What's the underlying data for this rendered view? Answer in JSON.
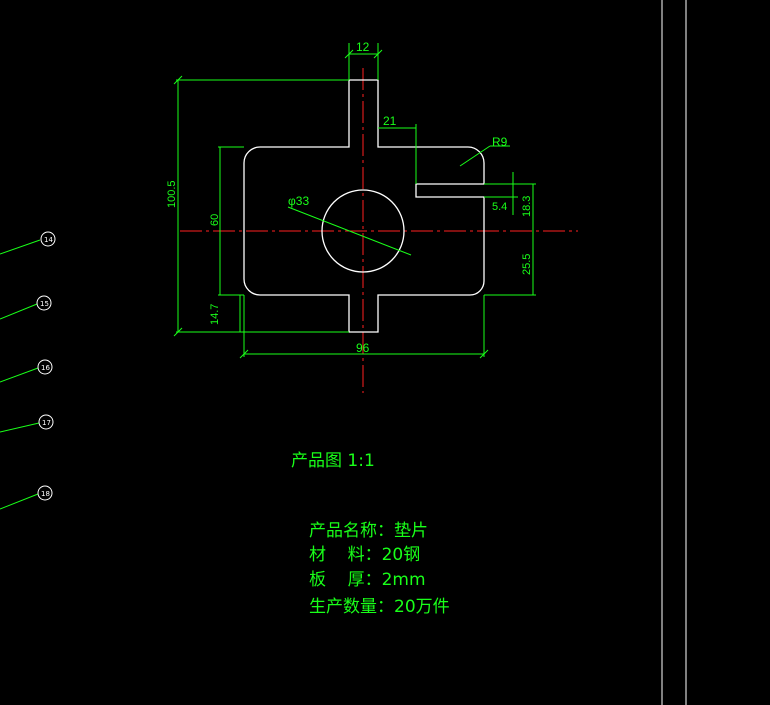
{
  "drawing": {
    "dimensions": {
      "width_12": "12",
      "width_21": "21",
      "radius_r9": "R9",
      "diameter_33": "φ33",
      "height_100_5": "100.5",
      "height_60": "60",
      "height_14_7": "14.7",
      "width_96": "96",
      "slot_5_4": "5.4",
      "slot_18_3": "18.3",
      "offset_25_5": "25.5"
    },
    "title": "产品图 1:1",
    "notes": [
      "产品名称：垫片",
      "材    料：20钢",
      "板    厚：2mm",
      "生产数量：20万件"
    ],
    "balloons": [
      "14",
      "15",
      "16",
      "17",
      "18"
    ]
  },
  "colors": {
    "background": "#000000",
    "geometry": "#ffffff",
    "dimension": "#19ff19",
    "centerline": "#ff2020"
  }
}
